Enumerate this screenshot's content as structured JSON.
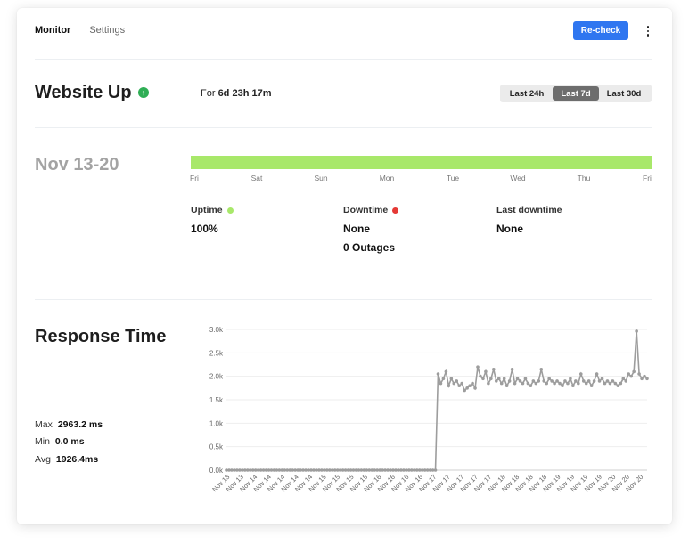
{
  "nav": {
    "tabs": [
      "Monitor",
      "Settings"
    ]
  },
  "toolbar": {
    "recheck_label": "Re-check",
    "more_icon": "more-vertical-icon"
  },
  "status": {
    "title": "Website Up",
    "icon": "arrow-up-icon",
    "color": "#2fae55",
    "duration_prefix": "For",
    "duration_value": "6d 23h 17m"
  },
  "range": {
    "options": [
      "Last 24h",
      "Last 7d",
      "Last 30d"
    ],
    "selected": "Last 7d"
  },
  "period": {
    "label": "Nov 13-20",
    "bar_color": "#a8e86a",
    "day_labels": [
      "Fri",
      "Sat",
      "Sun",
      "Mon",
      "Tue",
      "Wed",
      "Thu",
      "Fri"
    ]
  },
  "stats": {
    "uptime": {
      "label": "Uptime",
      "value": "100%",
      "dot_color": "#a8e86a"
    },
    "downtime": {
      "label": "Downtime",
      "value": "None",
      "extra": "0 Outages",
      "dot_color": "#e53935"
    },
    "last_downtime": {
      "label": "Last downtime",
      "value": "None"
    }
  },
  "response": {
    "title": "Response Time",
    "max_label": "Max",
    "max_value": "2963.2 ms",
    "min_label": "Min",
    "min_value": "0.0 ms",
    "avg_label": "Avg",
    "avg_value": "1926.4ms"
  },
  "chart_data": {
    "type": "line",
    "ylim": [
      0,
      3000
    ],
    "yticks": [
      0,
      500,
      1000,
      1500,
      2000,
      2500,
      3000
    ],
    "ytick_labels": [
      "0.0k",
      "0.5k",
      "1.0k",
      "1.5k",
      "2.0k",
      "2.5k",
      "3.0k"
    ],
    "grid": true,
    "xtick_labels": [
      "Nov 13",
      "Nov 13",
      "Nov 14",
      "Nov 14",
      "Nov 14",
      "Nov 14",
      "Nov 14",
      "Nov 15",
      "Nov 15",
      "Nov 15",
      "Nov 15",
      "Nov 16",
      "Nov 16",
      "Nov 16",
      "Nov 16",
      "Nov 17",
      "Nov 17",
      "Nov 17",
      "Nov 17",
      "Nov 17",
      "Nov 18",
      "Nov 18",
      "Nov 18",
      "Nov 18",
      "Nov 19",
      "Nov 19",
      "Nov 19",
      "Nov 19",
      "Nov 20",
      "Nov 20",
      "Nov 20"
    ],
    "values": [
      0,
      0,
      0,
      0,
      0,
      0,
      0,
      0,
      0,
      0,
      0,
      0,
      0,
      0,
      0,
      0,
      0,
      0,
      0,
      0,
      0,
      0,
      0,
      0,
      0,
      0,
      0,
      0,
      0,
      0,
      0,
      0,
      0,
      0,
      0,
      0,
      0,
      0,
      0,
      0,
      0,
      0,
      0,
      0,
      0,
      0,
      0,
      0,
      0,
      0,
      0,
      0,
      0,
      0,
      0,
      0,
      0,
      0,
      0,
      0,
      0,
      0,
      0,
      0,
      0,
      0,
      0,
      0,
      0,
      0,
      0,
      0,
      0,
      0,
      0,
      0,
      0,
      0,
      0,
      0,
      2050,
      1850,
      1950,
      2100,
      1800,
      1950,
      1850,
      1900,
      1800,
      1850,
      1700,
      1750,
      1800,
      1850,
      1750,
      2200,
      2000,
      1950,
      2100,
      1850,
      1950,
      2150,
      1900,
      1950,
      1850,
      1950,
      1800,
      1900,
      2150,
      1850,
      1950,
      1900,
      1850,
      1950,
      1850,
      1800,
      1900,
      1850,
      1900,
      2150,
      1900,
      1850,
      1950,
      1900,
      1850,
      1900,
      1850,
      1800,
      1900,
      1850,
      1950,
      1800,
      1900,
      1850,
      2050,
      1900,
      1850,
      1900,
      1800,
      1900,
      2050,
      1900,
      1950,
      1850,
      1900,
      1850,
      1900,
      1850,
      1800,
      1850,
      1950,
      1900,
      2050,
      2000,
      2100,
      2963,
      2050,
      1950,
      2000,
      1950
    ]
  },
  "chart_style": {
    "line_color": "#9d9d9d",
    "grid_color": "#eeeeee"
  }
}
